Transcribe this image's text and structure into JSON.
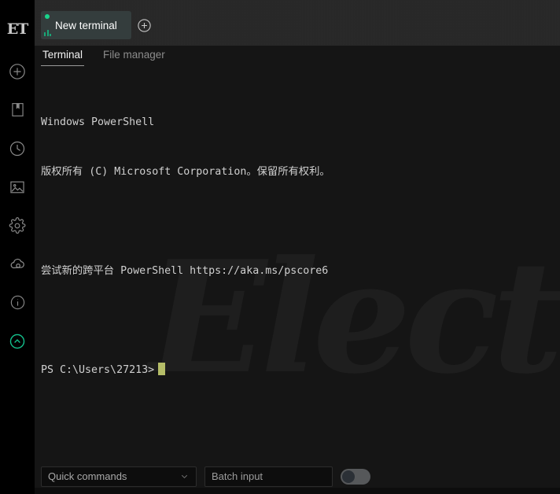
{
  "sidebar": {
    "logo": {
      "name": "electerm-logo",
      "text": "ET"
    },
    "items": [
      {
        "name": "add-icon",
        "label": "Add"
      },
      {
        "name": "bookmark-icon",
        "label": "Bookmarks"
      },
      {
        "name": "history-icon",
        "label": "History"
      },
      {
        "name": "gallery-icon",
        "label": "Theme / Gallery"
      },
      {
        "name": "gear-icon",
        "label": "Settings"
      },
      {
        "name": "cloud-icon",
        "label": "Sync"
      },
      {
        "name": "info-icon",
        "label": "Info"
      },
      {
        "name": "chevron-up-icon",
        "label": "Collapse",
        "active": true,
        "color": "#14c38e"
      }
    ]
  },
  "tabbar": {
    "tabs": [
      {
        "title": "New terminal",
        "status_color": "#19d48b",
        "active": true
      }
    ],
    "add_tab_icon": "plus-circle-icon"
  },
  "subtabs": [
    {
      "label": "Terminal",
      "active": true
    },
    {
      "label": "File manager",
      "active": false
    }
  ],
  "terminal": {
    "watermark": "Electe",
    "lines": [
      "Windows PowerShell",
      "版权所有 (C) Microsoft Corporation。保留所有权利。",
      "",
      "尝试新的跨平台 PowerShell https://aka.ms/pscore6",
      "",
      "PS C:\\Users\\27213>"
    ],
    "prompt": "PS C:\\Users\\27213>",
    "cursor_color": "#b5bd68"
  },
  "bottombar": {
    "quick_commands_label": "Quick commands",
    "quick_commands_icon": "chevron-down-icon",
    "batch_input_placeholder": "Batch input",
    "batch_input_value": "",
    "batch_toggle_state": "off"
  },
  "colors": {
    "accent_green": "#14c38e",
    "terminal_bg": "#151515",
    "sidebar_bg": "#000000",
    "tabbar_bg": "#262626",
    "tab_active_bg": "#343d3d"
  }
}
